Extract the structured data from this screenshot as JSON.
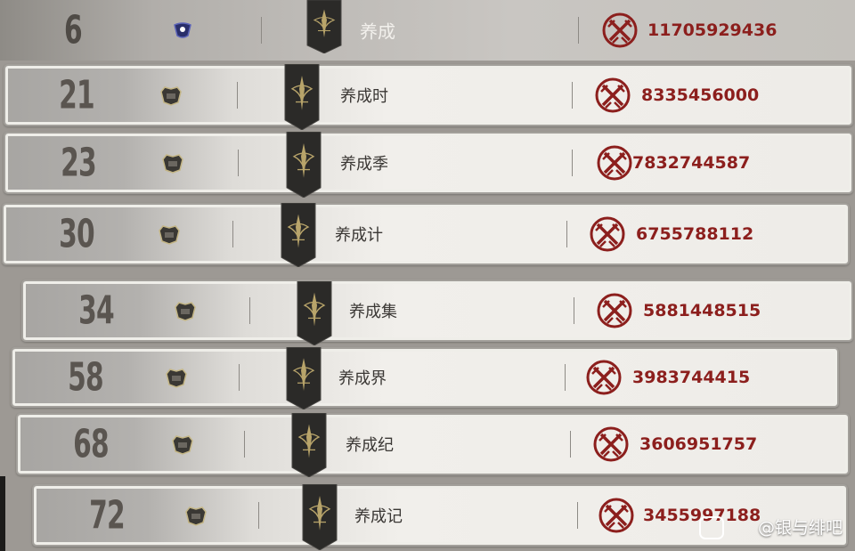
{
  "entries": [
    {
      "rank": "6",
      "name": "养成",
      "power": "11705929436"
    },
    {
      "rank": "21",
      "name": "养成时",
      "power": "8335456000"
    },
    {
      "rank": "23",
      "name": "养成季",
      "power": "7832744587"
    },
    {
      "rank": "30",
      "name": "养成计",
      "power": "6755788112"
    },
    {
      "rank": "34",
      "name": "养成集",
      "power": "5881448515"
    },
    {
      "rank": "58",
      "name": "养成界",
      "power": "3983744415"
    },
    {
      "rank": "68",
      "name": "养成纪",
      "power": "3606951757"
    },
    {
      "rank": "72",
      "name": "养成记",
      "power": "3455997188"
    }
  ],
  "watermark": "@银与绯吧",
  "icons": {
    "rank_crest": "guild-crest-icon",
    "banner": "guild-banner-icon",
    "power": "crossed-swords-icon"
  },
  "colors": {
    "power_text": "#8c1f1d",
    "name_text": "#3b3835",
    "banner": "#2b2a28",
    "gold": "#b8a46a"
  }
}
